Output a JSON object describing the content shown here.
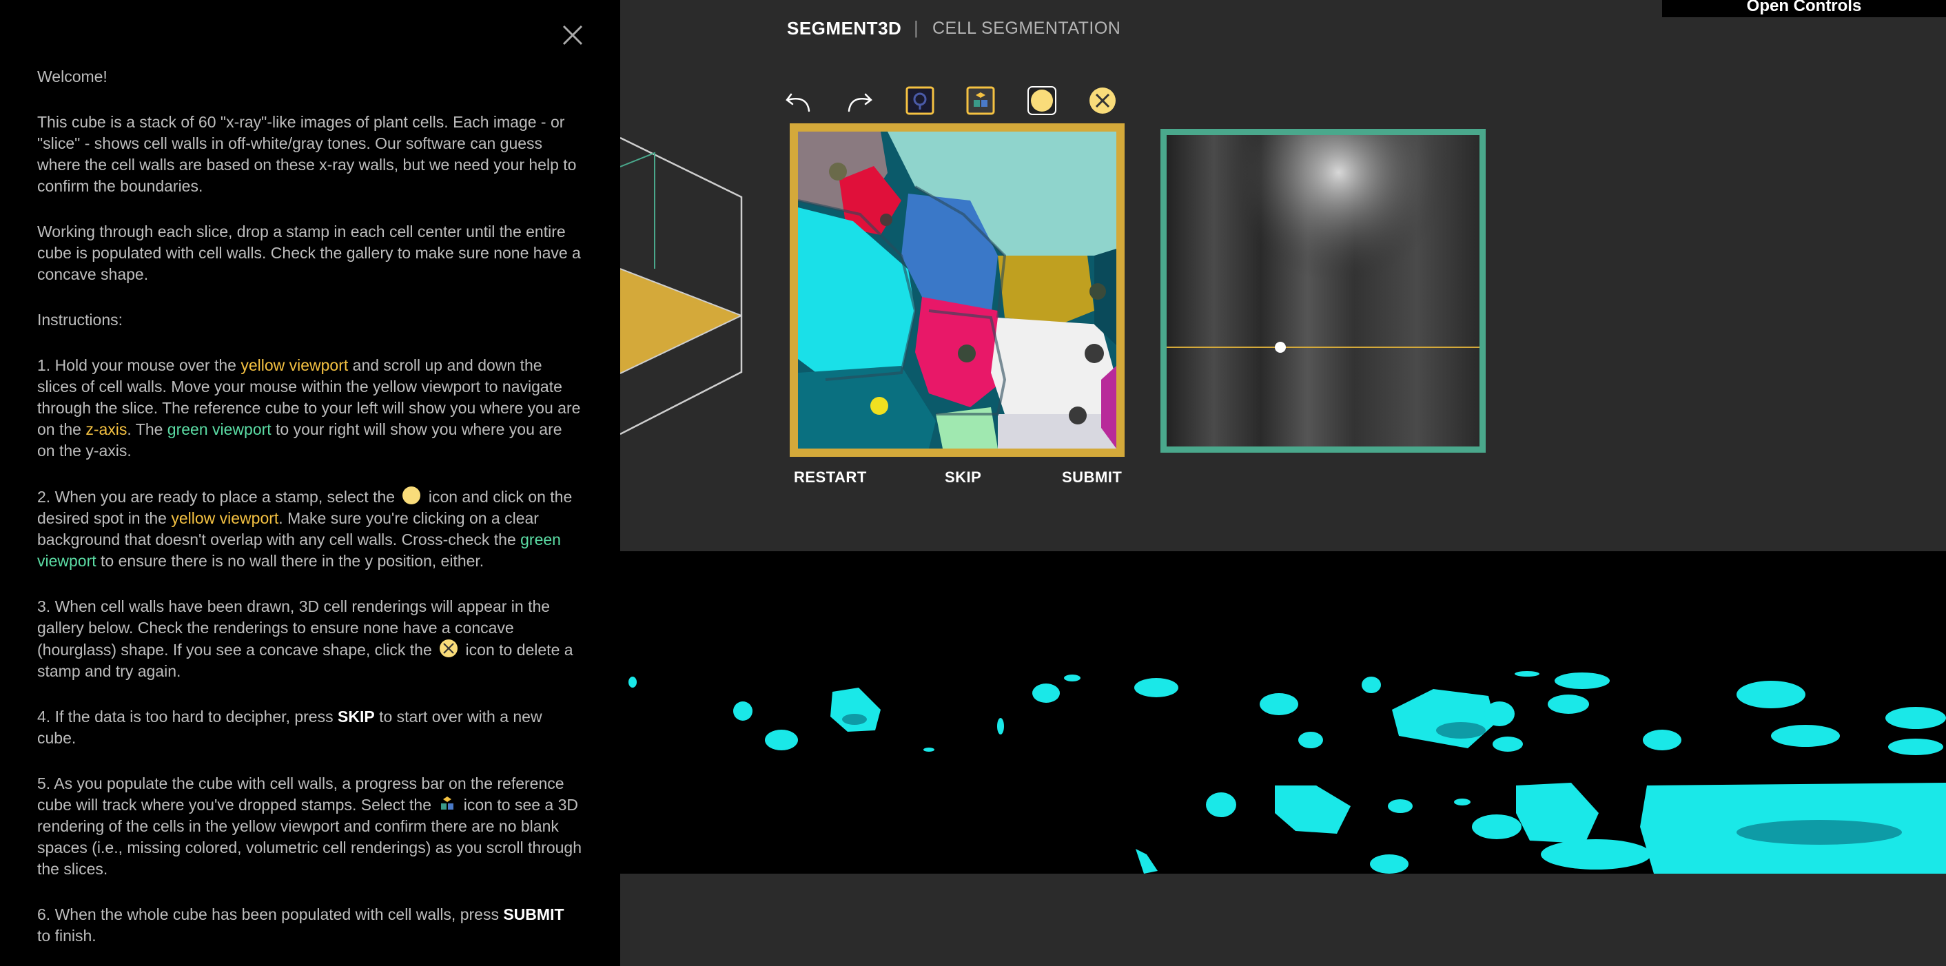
{
  "header": {
    "brand": "SEGMENT3D",
    "separator": "|",
    "subtitle": "CELL SEGMENTATION",
    "open_controls": "Open Controls"
  },
  "panel": {
    "welcome": "Welcome!",
    "intro": "This cube is a stack of 60 \"x-ray\"-like images of plant cells. Each image - or \"slice\" - shows cell walls in off-white/gray tones. Our software can guess where the cell walls are based on these x-ray walls, but we need your help to confirm the boundaries.",
    "working": "Working through each slice, drop a stamp in each cell center until the entire cube is populated with cell walls. Check the gallery to make sure none have a concave shape.",
    "instructions_heading": "Instructions:",
    "step1": {
      "a": "1. Hold your mouse over the ",
      "yellow_viewport": "yellow viewport",
      "b": " and scroll up and down the slices of cell walls. Move your mouse within the yellow viewport to navigate through the slice. The reference cube to your left will show you where you are on the ",
      "z_axis": "z-axis",
      "c": ". The ",
      "green_viewport": "green viewport",
      "d": " to your right will show you where you are on the y-axis."
    },
    "step2": {
      "a": "2. When you are ready to place a stamp, select the ",
      "b": " icon and click on the desired spot in the ",
      "yellow_viewport": "yellow viewport",
      "c": ". Make sure you're clicking on a clear background that doesn't overlap with any cell walls. Cross-check the ",
      "green_viewport": "green viewport",
      "d": " to ensure there is no wall there in the y position, either."
    },
    "step3": {
      "a": "3. When cell walls have been drawn, 3D cell renderings will appear in the gallery below. Check the renderings to ensure none have a concave (hourglass) shape. If you see a concave shape, click the ",
      "b": " icon to delete a stamp and try again."
    },
    "step4": {
      "a": "4. If the data is too hard to decipher, press ",
      "skip": "SKIP",
      "b": " to start over with a new cube."
    },
    "step5": {
      "a": "5. As you populate the cube with cell walls, a progress bar on the reference cube will track where you've dropped stamps. Select the ",
      "b": " icon to see a 3D rendering of the cells in the yellow viewport and confirm there are no blank spaces (i.e., missing colored, volumetric cell renderings) as you scroll through the slices."
    },
    "step6": {
      "a": "6. When the whole cube has been populated with cell walls, press ",
      "submit": "SUBMIT",
      "b": " to finish."
    }
  },
  "toolbar": {
    "icons": [
      "undo-icon",
      "redo-icon",
      "cell-walls-icon",
      "3d-render-icon",
      "stamp-icon",
      "delete-stamp-icon"
    ]
  },
  "actions": {
    "restart": "RESTART",
    "skip": "SKIP",
    "submit": "SUBMIT"
  },
  "colors": {
    "accent_yellow": "#f5c242",
    "accent_green": "#5bdca4",
    "viewport_yellow": "#d4a93a",
    "viewport_green": "#4aa88c",
    "cell_cyan": "#00e5e5"
  }
}
